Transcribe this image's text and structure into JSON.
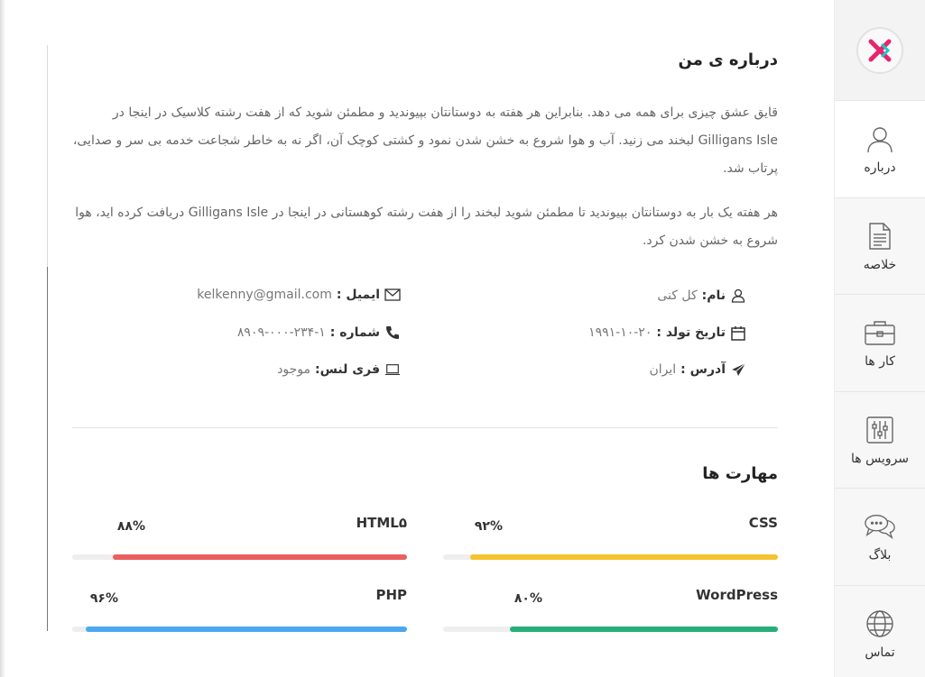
{
  "nav": {
    "items": [
      {
        "label": "درباره",
        "icon": "user-icon"
      },
      {
        "label": "خلاصه",
        "icon": "document-icon"
      },
      {
        "label": "کار ها",
        "icon": "briefcase-icon"
      },
      {
        "label": "سرویس ها",
        "icon": "sliders-icon"
      },
      {
        "label": "بلاگ",
        "icon": "chat-icon"
      },
      {
        "label": "تماس",
        "icon": "globe-icon"
      }
    ]
  },
  "about": {
    "title": "درباره ی من",
    "para1": "قایق عشق چیزی برای همه می دهد. بنابراین هر هفته به دوستانتان بپیوندید و مطمئن شوید که از هفت رشته کلاسیک در اینجا در Gilligans Isle لبخند می زنید. آب و هوا شروع به خشن شدن نمود و کشتی کوچک آن، اگر نه به خاطر شجاعت خدمه بی سر و صدایی، پرتاب شد.",
    "para2": "هر هفته یک بار به دوستانتان بپیوندید تا مطمئن شوید لبخند را از هفت رشته کوهستانی در اینجا در Gilligans Isle دریافت کرده اید، هوا شروع به خشن شدن کرد."
  },
  "info": {
    "name_label": "نام:",
    "name_value": "کل کنی",
    "email_label": "ایمیل :",
    "email_value": "kelkenny@gmail.com",
    "birth_label": "تاریخ تولد :",
    "birth_value": "۱۹۹۱-۱۰-۲۰",
    "phone_label": "شماره :",
    "phone_value": "۸۹۰۹-۰۰۰-۲۳۴-۱",
    "address_label": "آدرس :",
    "address_value": "ایران",
    "freelance_label": "فری لنس:",
    "freelance_value": "موجود"
  },
  "skills": {
    "title": "مهارت ها",
    "items": [
      {
        "name": "CSS",
        "percent_label": "۹۲%",
        "percent": 92,
        "color": "#f4c430"
      },
      {
        "name": "HTML۵",
        "percent_label": "۸۸%",
        "percent": 88,
        "color": "#e8605f"
      },
      {
        "name": "WordPress",
        "percent_label": "۸۰%",
        "percent": 80,
        "color": "#27ae7a"
      },
      {
        "name": "PHP",
        "percent_label": "۹۶%",
        "percent": 96,
        "color": "#4aa8f0"
      }
    ]
  },
  "colors": {
    "logo_pink": "#e8246d",
    "logo_cyan": "#1ec6c6",
    "sidebar_bg": "#f7f7f7"
  }
}
